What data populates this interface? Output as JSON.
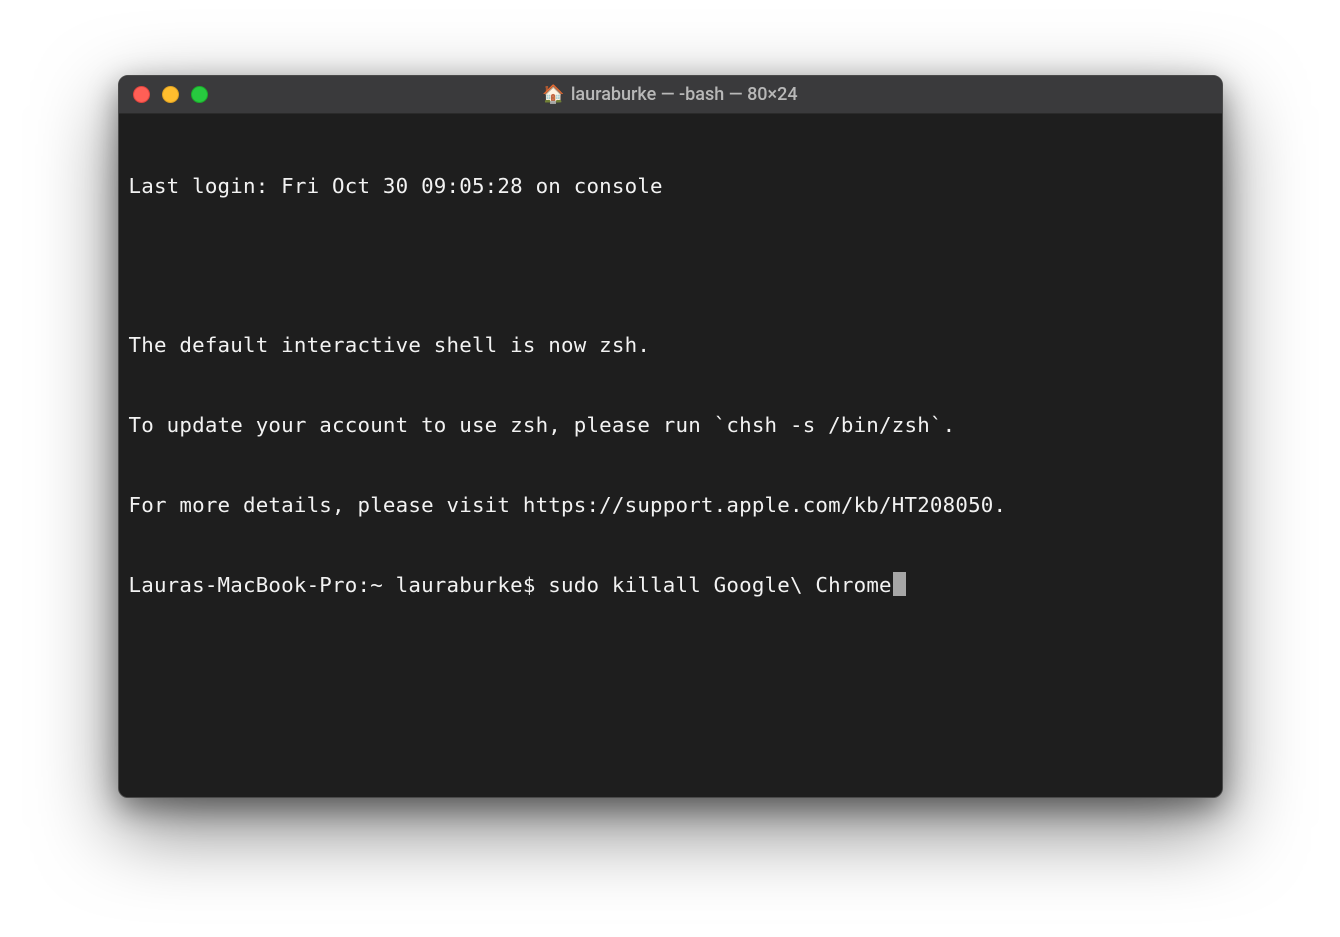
{
  "window": {
    "title": "lauraburke — -bash — 80×24",
    "icon_name": "home-icon"
  },
  "terminal": {
    "lines": [
      "Last login: Fri Oct 30 09:05:28 on console",
      "",
      "The default interactive shell is now zsh.",
      "To update your account to use zsh, please run `chsh -s /bin/zsh`.",
      "For more details, please visit https://support.apple.com/kb/HT208050."
    ],
    "prompt": "Lauras-MacBook-Pro:~ lauraburke$ ",
    "command": "sudo killall Google\\ Chrome"
  }
}
